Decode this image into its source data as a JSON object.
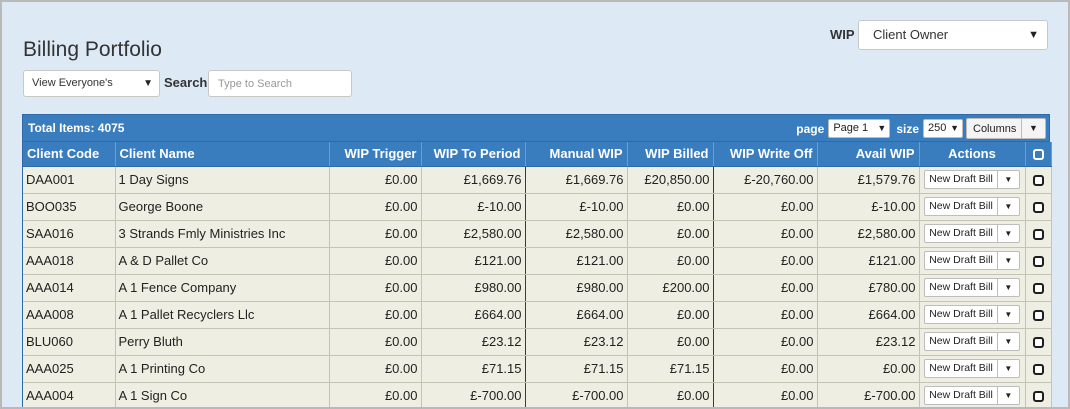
{
  "page": {
    "title": "Billing Portfolio",
    "view_select": "View Everyone's",
    "search_label": "Search",
    "search_placeholder": "Type to Search",
    "wip_label": "WIP",
    "wip_select": "Client Owner"
  },
  "toolbar": {
    "total": "Total Items: 4075",
    "page_label": "page",
    "page_value": "Page 1",
    "size_label": "size",
    "size_value": "250",
    "columns_label": "Columns"
  },
  "headers": [
    "Client Code",
    "Client Name",
    "WIP Trigger",
    "WIP To Period",
    "Manual WIP",
    "WIP Billed",
    "WIP Write Off",
    "Avail WIP",
    "Actions"
  ],
  "action_label": "New Draft Bill",
  "rows": [
    {
      "code": "DAA001",
      "name": "1 Day Signs",
      "trigger": "£0.00",
      "to_period": "£1,669.76",
      "manual": "£1,669.76",
      "billed": "£20,850.00",
      "write_off": "£-20,760.00",
      "avail": "£1,579.76"
    },
    {
      "code": "BOO035",
      "name": "George Boone",
      "trigger": "£0.00",
      "to_period": "£-10.00",
      "manual": "£-10.00",
      "billed": "£0.00",
      "write_off": "£0.00",
      "avail": "£-10.00"
    },
    {
      "code": "SAA016",
      "name": "3 Strands Fmly Ministries Inc",
      "trigger": "£0.00",
      "to_period": "£2,580.00",
      "manual": "£2,580.00",
      "billed": "£0.00",
      "write_off": "£0.00",
      "avail": "£2,580.00"
    },
    {
      "code": "AAA018",
      "name": "A & D Pallet Co",
      "trigger": "£0.00",
      "to_period": "£121.00",
      "manual": "£121.00",
      "billed": "£0.00",
      "write_off": "£0.00",
      "avail": "£121.00"
    },
    {
      "code": "AAA014",
      "name": "A 1 Fence Company",
      "trigger": "£0.00",
      "to_period": "£980.00",
      "manual": "£980.00",
      "billed": "£200.00",
      "write_off": "£0.00",
      "avail": "£780.00"
    },
    {
      "code": "AAA008",
      "name": "A 1 Pallet Recyclers Llc",
      "trigger": "£0.00",
      "to_period": "£664.00",
      "manual": "£664.00",
      "billed": "£0.00",
      "write_off": "£0.00",
      "avail": "£664.00"
    },
    {
      "code": "BLU060",
      "name": "Perry Bluth",
      "trigger": "£0.00",
      "to_period": "£23.12",
      "manual": "£23.12",
      "billed": "£0.00",
      "write_off": "£0.00",
      "avail": "£23.12"
    },
    {
      "code": "AAA025",
      "name": "A 1 Printing Co",
      "trigger": "£0.00",
      "to_period": "£71.15",
      "manual": "£71.15",
      "billed": "£71.15",
      "write_off": "£0.00",
      "avail": "£0.00"
    },
    {
      "code": "AAA004",
      "name": "A 1 Sign Co",
      "trigger": "£0.00",
      "to_period": "£-700.00",
      "manual": "£-700.00",
      "billed": "£0.00",
      "write_off": "£0.00",
      "avail": "£-700.00"
    }
  ]
}
